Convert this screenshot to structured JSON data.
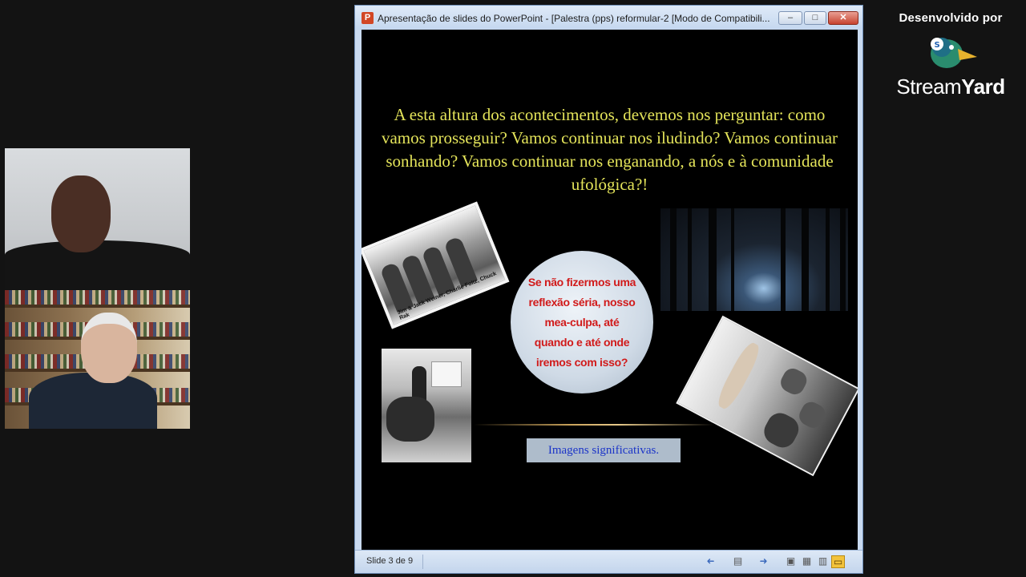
{
  "window": {
    "title": "Apresentação de slides do PowerPoint - [Palestra (pps) reformular-2 [Modo de Compatibili...",
    "app_icon_letter": "P",
    "minimize_symbol": "–",
    "maximize_symbol": "□",
    "close_symbol": "✕"
  },
  "slide": {
    "heading": "A esta altura dos acontecimentos, devemos nos perguntar: como vamos prosseguir? Vamos continuar nos iludindo? Vamos continuar sonhando? Vamos continuar nos enganando, a nós e à comunidade ufológica?!",
    "circle_text": "Se não fizermos uma reflexão séria, nosso mea-culpa, até quando e até onde iremos com isso?",
    "caption": "Imagens significativas.",
    "photo_caption": "Jim & Jack Weiner, Charlie Foltz, Chuck Rak"
  },
  "status_bar": {
    "slide_counter": "Slide 3 de 9"
  },
  "branding": {
    "developed_by": "Desenvolvido por",
    "name_part1": "Stream",
    "name_part2": "Yard"
  },
  "colors": {
    "slide_text": "#e4e45a",
    "circle_text": "#d11a1a",
    "caption_text": "#1b34c8"
  }
}
